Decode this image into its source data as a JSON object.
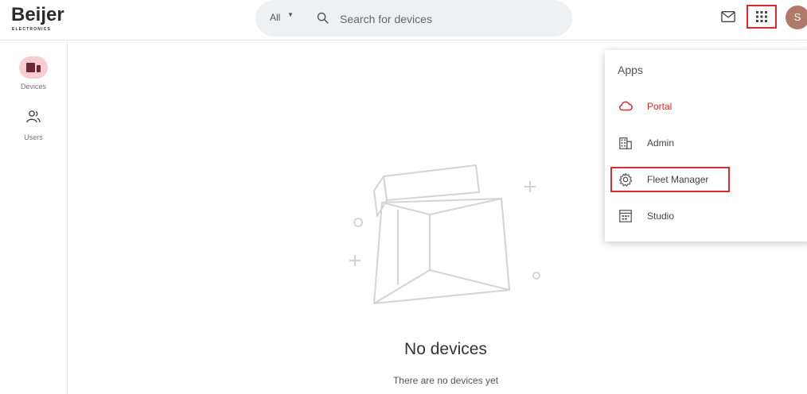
{
  "header": {
    "logo_text": "Beijer",
    "logo_subtext": "ELECTRONICS",
    "search": {
      "scope": "All",
      "placeholder": "Search for devices"
    },
    "avatar_initial": "S"
  },
  "sidebar": {
    "items": [
      {
        "label": "Devices",
        "icon": "devices-icon",
        "active": true
      },
      {
        "label": "Users",
        "icon": "users-icon",
        "active": false
      }
    ]
  },
  "empty_state": {
    "title": "No devices",
    "subtitle": "There are no devices yet"
  },
  "apps_menu": {
    "heading": "Apps",
    "items": [
      {
        "label": "Portal",
        "icon": "cloud-icon",
        "active": true
      },
      {
        "label": "Admin",
        "icon": "building-icon",
        "active": false
      },
      {
        "label": "Fleet Manager",
        "icon": "gear-icon",
        "active": false,
        "highlighted": true
      },
      {
        "label": "Studio",
        "icon": "studio-icon",
        "active": false
      }
    ]
  },
  "colors": {
    "accent": "#e0292b",
    "active_pill": "#f8cdd2",
    "search_bg": "#eef0f2",
    "avatar_bg": "#b07a6a"
  }
}
